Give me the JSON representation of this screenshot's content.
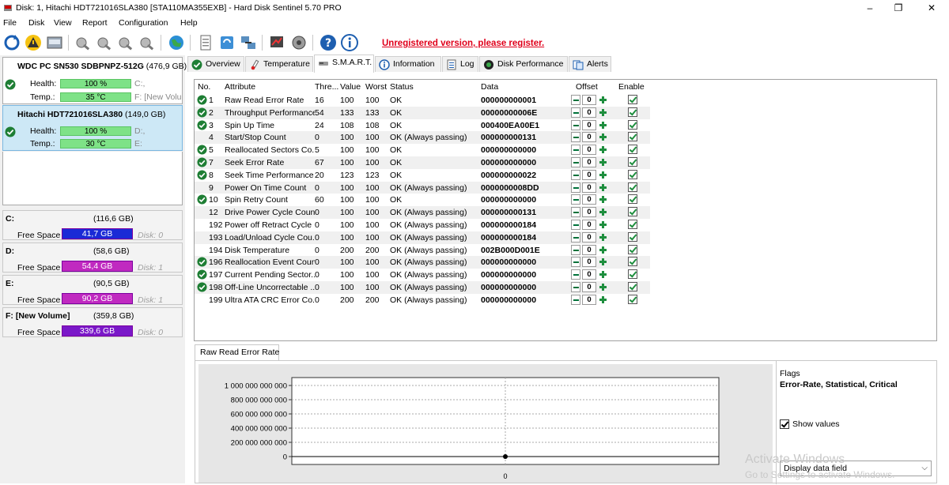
{
  "window": {
    "title": "Disk: 1, Hitachi HDT721016SLA380 [STA110MA355EXB]  -  Hard Disk Sentinel 5.70 PRO",
    "minimize": "–",
    "maximize": "❐",
    "close": "✕"
  },
  "menu": [
    "File",
    "Disk",
    "View",
    "Report",
    "Configuration",
    "Help"
  ],
  "toolbar": {
    "unregistered": "Unregistered version, please register."
  },
  "disks": [
    {
      "name": "WDC PC SN530 SDBPNPZ-512G",
      "size": "(476,9 GB)",
      "health_label": "Health:",
      "health": "100 %",
      "health_drive": "C:,",
      "temp_label": "Temp.:",
      "temp": "35 °C",
      "temp_drive": "F: [New Volume]"
    },
    {
      "name": "Hitachi HDT721016SLA380",
      "size": "(149,0 GB)",
      "health_label": "Health:",
      "health": "100 %",
      "health_drive": "D:,",
      "temp_label": "Temp.:",
      "temp": "30 °C",
      "temp_drive": "E:"
    }
  ],
  "volumes": [
    {
      "name": "C:",
      "size": "(116,6 GB)",
      "free_label": "Free Space",
      "free": "41,7 GB",
      "free_fraction": 0.36,
      "disk": "Disk: 0",
      "color": "#1a2ad6"
    },
    {
      "name": "D:",
      "size": "(58,6 GB)",
      "free_label": "Free Space",
      "free": "54,4 GB",
      "free_fraction": 0.93,
      "disk": "Disk: 1",
      "color": "#c02ac0"
    },
    {
      "name": "E:",
      "size": "(90,5 GB)",
      "free_label": "Free Space",
      "free": "90,2 GB",
      "free_fraction": 0.99,
      "disk": "Disk: 1",
      "color": "#c02ac0"
    },
    {
      "name": "F: [New Volume]",
      "size": "(359,8 GB)",
      "free_label": "Free Space",
      "free": "339,6 GB",
      "free_fraction": 0.94,
      "disk": "Disk: 0",
      "color": "#7a18c8"
    }
  ],
  "tabs": [
    "Overview",
    "Temperature",
    "S.M.A.R.T.",
    "Information",
    "Log",
    "Disk Performance",
    "Alerts"
  ],
  "smart": {
    "headers": {
      "no": "No.",
      "attribute": "Attribute",
      "threshold": "Thre...",
      "value": "Value",
      "worst": "Worst",
      "status": "Status",
      "data": "Data",
      "offset": "Offset",
      "enable": "Enable"
    },
    "rows": [
      {
        "ok": true,
        "no": "1",
        "attribute": "Raw Read Error Rate",
        "threshold": "16",
        "value": "100",
        "worst": "100",
        "status": "OK",
        "data": "000000000001",
        "offset": "0"
      },
      {
        "ok": true,
        "no": "2",
        "attribute": "Throughput Performance",
        "threshold": "54",
        "value": "133",
        "worst": "133",
        "status": "OK",
        "data": "00000000006E",
        "offset": "0"
      },
      {
        "ok": true,
        "no": "3",
        "attribute": "Spin Up Time",
        "threshold": "24",
        "value": "108",
        "worst": "108",
        "status": "OK",
        "data": "000400EA00E1",
        "offset": "0"
      },
      {
        "ok": false,
        "no": "4",
        "attribute": "Start/Stop Count",
        "threshold": "0",
        "value": "100",
        "worst": "100",
        "status": "OK (Always passing)",
        "data": "000000000131",
        "offset": "0"
      },
      {
        "ok": true,
        "no": "5",
        "attribute": "Reallocated Sectors Co...",
        "threshold": "5",
        "value": "100",
        "worst": "100",
        "status": "OK",
        "data": "000000000000",
        "offset": "0"
      },
      {
        "ok": true,
        "no": "7",
        "attribute": "Seek Error Rate",
        "threshold": "67",
        "value": "100",
        "worst": "100",
        "status": "OK",
        "data": "000000000000",
        "offset": "0"
      },
      {
        "ok": true,
        "no": "8",
        "attribute": "Seek Time Performance",
        "threshold": "20",
        "value": "123",
        "worst": "123",
        "status": "OK",
        "data": "000000000022",
        "offset": "0"
      },
      {
        "ok": false,
        "no": "9",
        "attribute": "Power On Time Count",
        "threshold": "0",
        "value": "100",
        "worst": "100",
        "status": "OK (Always passing)",
        "data": "0000000008DD",
        "offset": "0"
      },
      {
        "ok": true,
        "no": "10",
        "attribute": "Spin Retry Count",
        "threshold": "60",
        "value": "100",
        "worst": "100",
        "status": "OK",
        "data": "000000000000",
        "offset": "0"
      },
      {
        "ok": false,
        "no": "12",
        "attribute": "Drive Power Cycle Count",
        "threshold": "0",
        "value": "100",
        "worst": "100",
        "status": "OK (Always passing)",
        "data": "000000000131",
        "offset": "0"
      },
      {
        "ok": false,
        "no": "192",
        "attribute": "Power off Retract Cycle ...",
        "threshold": "0",
        "value": "100",
        "worst": "100",
        "status": "OK (Always passing)",
        "data": "000000000184",
        "offset": "0"
      },
      {
        "ok": false,
        "no": "193",
        "attribute": "Load/Unload Cycle Cou...",
        "threshold": "0",
        "value": "100",
        "worst": "100",
        "status": "OK (Always passing)",
        "data": "000000000184",
        "offset": "0"
      },
      {
        "ok": false,
        "no": "194",
        "attribute": "Disk Temperature",
        "threshold": "0",
        "value": "200",
        "worst": "200",
        "status": "OK (Always passing)",
        "data": "002B000D001E",
        "offset": "0"
      },
      {
        "ok": true,
        "no": "196",
        "attribute": "Reallocation Event Count",
        "threshold": "0",
        "value": "100",
        "worst": "100",
        "status": "OK (Always passing)",
        "data": "000000000000",
        "offset": "0"
      },
      {
        "ok": true,
        "no": "197",
        "attribute": "Current Pending Sector...",
        "threshold": "0",
        "value": "100",
        "worst": "100",
        "status": "OK (Always passing)",
        "data": "000000000000",
        "offset": "0"
      },
      {
        "ok": true,
        "no": "198",
        "attribute": "Off-Line Uncorrectable ...",
        "threshold": "0",
        "value": "100",
        "worst": "100",
        "status": "OK (Always passing)",
        "data": "000000000000",
        "offset": "0"
      },
      {
        "ok": false,
        "no": "199",
        "attribute": "Ultra ATA CRC Error Co...",
        "threshold": "0",
        "value": "200",
        "worst": "200",
        "status": "OK (Always passing)",
        "data": "000000000000",
        "offset": "0"
      }
    ]
  },
  "chart": {
    "tab": "Raw Read Error Rate",
    "flags_label": "Flags",
    "flags": "Error-Rate, Statistical, Critical",
    "show_values": "Show values",
    "dropdown": "Display data field"
  },
  "chart_data": {
    "type": "line",
    "title": "",
    "xlabel": "",
    "ylabel": "",
    "ylim": [
      0,
      1000000000000
    ],
    "yticks": [
      "1 000 000 000 000",
      "800 000 000 000",
      "600 000 000 000",
      "400 000 000 000",
      "200 000 000 000",
      "0"
    ],
    "series": [
      {
        "values": [
          1
        ]
      }
    ],
    "marker_label": "0"
  },
  "watermark": {
    "line1": "Activate Windows",
    "line2": "Go to Settings to activate Windows."
  }
}
